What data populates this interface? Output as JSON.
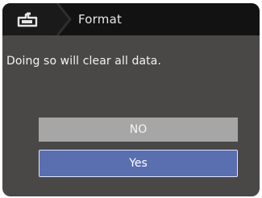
{
  "header": {
    "menu_icon": "camera-setup-menu-icon",
    "title": "Format"
  },
  "dialog": {
    "message": "Doing so will clear all data.",
    "options": [
      {
        "label": "NO",
        "selected": false
      },
      {
        "label": "Yes",
        "selected": true
      }
    ]
  },
  "colors": {
    "background": "#4a4847",
    "titlebar": "#121212",
    "no_button": "#a6a6a6",
    "yes_button_selected": "#5a6fb0"
  }
}
